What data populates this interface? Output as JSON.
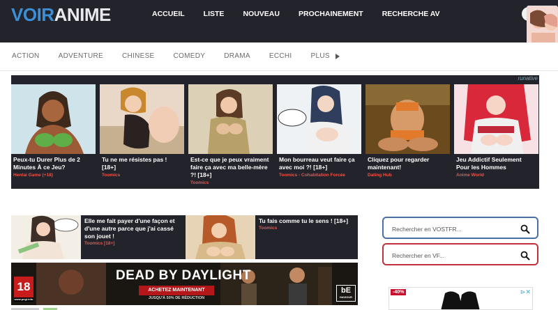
{
  "header": {
    "logo_part1": "VOIR",
    "logo_part2": "ANIME",
    "nav": [
      "ACCUEIL",
      "LISTE",
      "NOUVEAU",
      "PROCHAINEMENT",
      "RECHERCHE AV"
    ]
  },
  "categories": {
    "items": [
      "ACTION",
      "ADVENTURE",
      "CHINESE",
      "COMEDY",
      "DRAMA",
      "ECCHI"
    ],
    "more_label": "PLUS"
  },
  "native_ads": {
    "badge": "runative",
    "tiles": [
      {
        "caption": "Peux-tu Durer Plus de 2 Minutes À ce Jeu?",
        "source": "Hentai Game (+18)"
      },
      {
        "caption": "Tu ne me résistes pas ! [18+]",
        "source": "Toomics"
      },
      {
        "caption": "Est-ce que je peux vraiment faire ça avec ma belle-mère ?! [18+]",
        "source": "Toomics"
      },
      {
        "caption": "Mon bourreau veut faire ça avec moi ?! [18+]",
        "source": "Toomics - Cohabitation Forcée"
      },
      {
        "caption": "Cliquez pour regarder maintenant!",
        "source": "Dating Hub"
      },
      {
        "caption": "Jeu Addictif Seulement Pour les Hommes",
        "source": "Anime World"
      }
    ]
  },
  "strip_ads": [
    {
      "caption": "Elle me fait payer d'une façon et d'une autre parce que j'ai cassé son jouet !",
      "source": "Toomics [18+]"
    },
    {
      "caption": "Tu fais comme tu le sens ! [18+]",
      "source": "Toomics"
    }
  ],
  "banner": {
    "title": "DEAD BY DAYLIGHT",
    "cta": "ACHETEZ MAINTENANT",
    "sub": "JUSQU'À 50% DE RÉDUCTION",
    "pegi": "18",
    "pegi_site": "www.pegi.info",
    "publisher": "bE",
    "publisher_sub": "HAVIOUR"
  },
  "search": {
    "vostfr_placeholder": "Rechercher en VOSTFR...",
    "vf_placeholder": "Rechercher en VF..."
  },
  "side_ad": {
    "discount": "-40%"
  },
  "colors": {
    "header_bg": "#23232b",
    "logo_blue": "#3b8fd6",
    "ad_source_red": "#e9564b",
    "search_border_blue": "#4a6fa3",
    "search_border_red": "#c0323a"
  }
}
